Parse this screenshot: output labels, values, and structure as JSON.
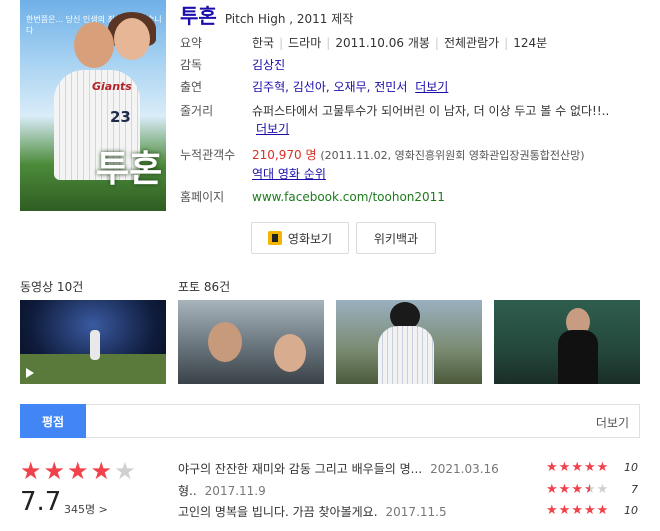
{
  "movie": {
    "title": "투혼",
    "subtitle": "Pitch High , 2011 제작",
    "poster_title": "투혼",
    "poster_tagline": "한번쯤은... 당신 인생의 최고이고 싶습니다",
    "poster_number": "23"
  },
  "info": {
    "summary_label": "요약",
    "summary": [
      "한국",
      "드라마",
      "2011.10.06 개봉",
      "전체관람가",
      "124분"
    ],
    "director_label": "감독",
    "director": "김상진",
    "cast_label": "출연",
    "cast": "김주혁, 김선아, 오재무, 전민서",
    "cast_more": "더보기",
    "plot_label": "줄거리",
    "plot": "슈퍼스타에서 고물투수가 되어버린 이 남자, 더 이상 두고 볼 수 없다!!..",
    "plot_more": "더보기",
    "audience_label": "누적관객수",
    "audience_count": "210,970 명",
    "audience_source": "(2011.11.02, 영화진흥위원회 영화관입장권통합전산망)",
    "audience_rank_link": "역대 영화 순위",
    "homepage_label": "홈페이지",
    "homepage": "www.facebook.com/toohon2011"
  },
  "buttons": {
    "watch": "영화보기",
    "wiki": "위키백과"
  },
  "media": {
    "videos_label": "동영상 10건",
    "photos_label": "포토 86건"
  },
  "ratings": {
    "tab_label": "평점",
    "more_label": "더보기",
    "score": "7.7",
    "count": "345명 >",
    "stars_on": 4,
    "stars_total": 5,
    "reviews": [
      {
        "text": "야구의 잔잔한 재미와 감동 그리고 배우들의 명...",
        "date": "2021.03.16",
        "score": "10"
      },
      {
        "text": "형..",
        "date": "2017.11.9",
        "score": "7"
      },
      {
        "text": "고인의 명복을 빕니다. 가끔 찾아볼게요.",
        "date": "2017.11.5",
        "score": "10"
      }
    ]
  },
  "colors": {
    "link": "#1a0dab",
    "accent": "#4285f4",
    "star": "#f0424a",
    "audience": "#d93025",
    "homepage": "#1e7a1e"
  }
}
